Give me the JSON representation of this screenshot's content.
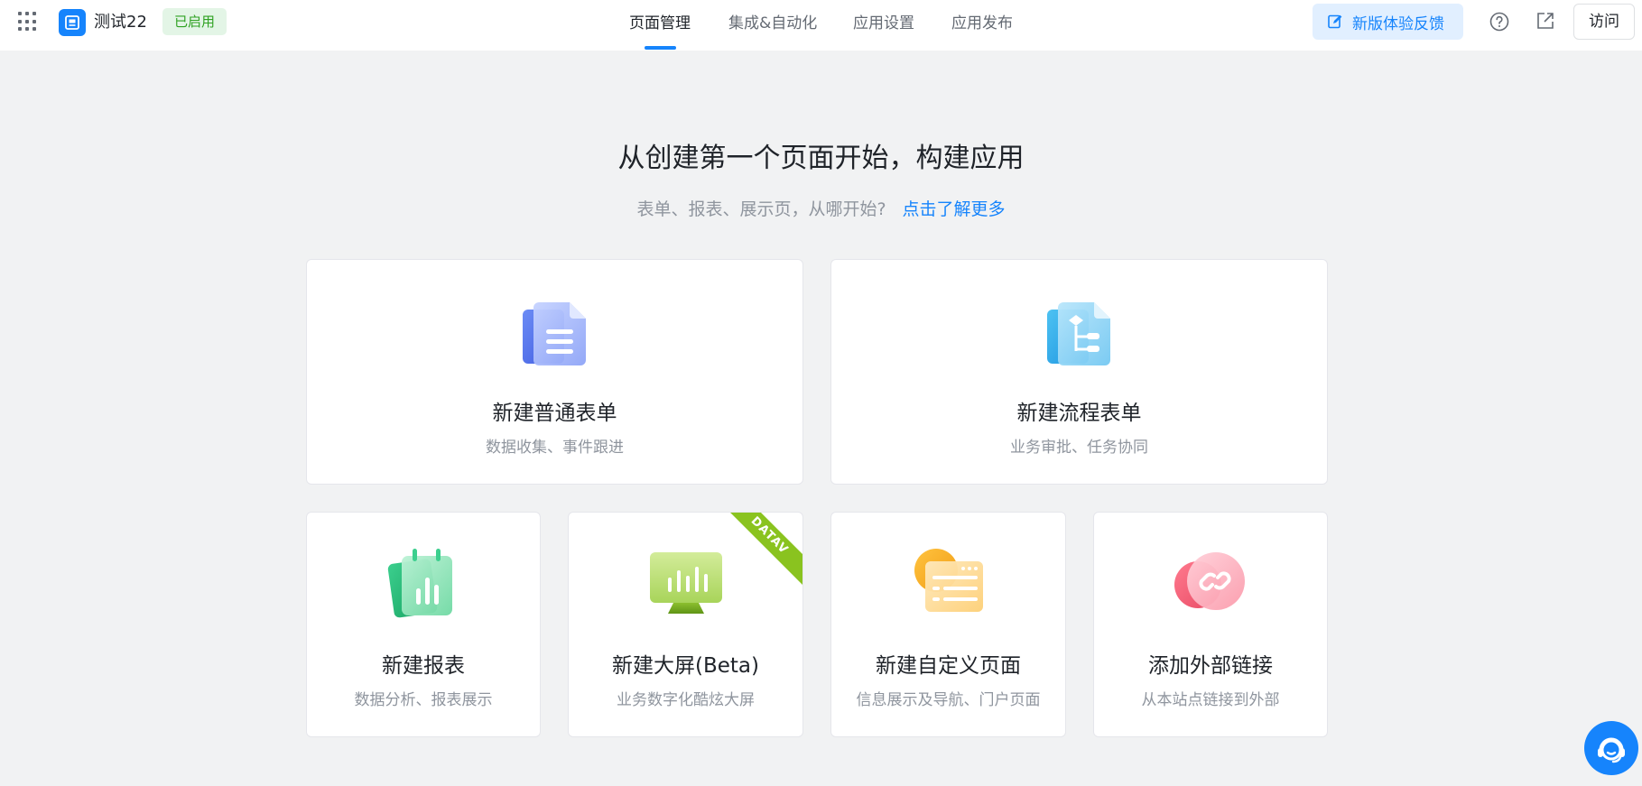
{
  "header": {
    "app_name": "测试22",
    "status": "已启用",
    "tabs": [
      {
        "label": "页面管理",
        "active": true
      },
      {
        "label": "集成&自动化",
        "active": false
      },
      {
        "label": "应用设置",
        "active": false
      },
      {
        "label": "应用发布",
        "active": false
      }
    ],
    "feedback_label": "新版体验反馈",
    "visit_label": "访问",
    "accent_color": "#1684fc"
  },
  "hero": {
    "title": "从创建第一个页面开始，构建应用",
    "subtitle": "表单、报表、展示页，从哪开始?",
    "link": "点击了解更多"
  },
  "cards": [
    {
      "title": "新建普通表单",
      "desc": "数据收集、事件跟进",
      "icon": "form-icon"
    },
    {
      "title": "新建流程表单",
      "desc": "业务审批、任务协同",
      "icon": "process-form-icon"
    },
    {
      "title": "新建报表",
      "desc": "数据分析、报表展示",
      "icon": "report-icon"
    },
    {
      "title": "新建大屏(Beta)",
      "desc": "业务数字化酷炫大屏",
      "icon": "dashboard-screen-icon",
      "ribbon": "DATAV"
    },
    {
      "title": "新建自定义页面",
      "desc": "信息展示及导航、门户页面",
      "icon": "custom-page-icon"
    },
    {
      "title": "添加外部链接",
      "desc": "从本站点链接到外部",
      "icon": "external-link-icon"
    }
  ]
}
